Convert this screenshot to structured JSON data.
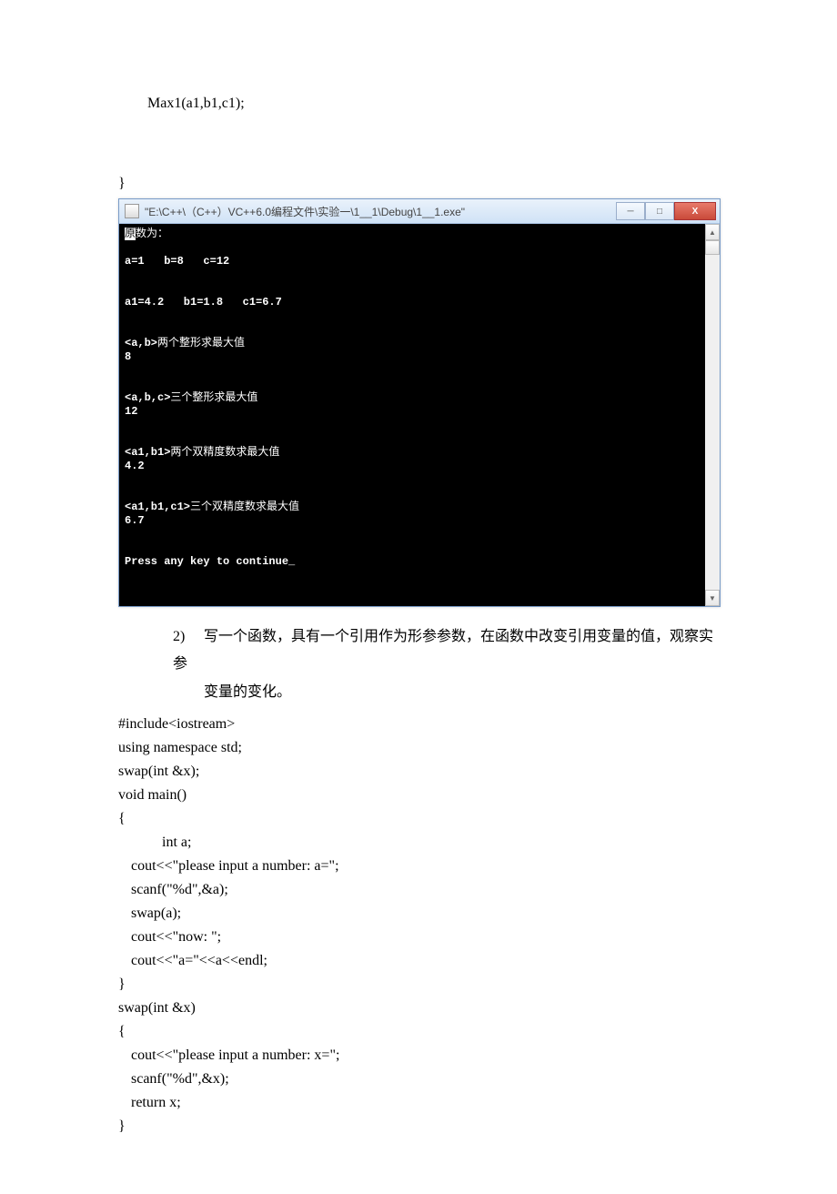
{
  "precode": {
    "l1": "Max1(a1,b1,c1);",
    "l2": "}"
  },
  "window": {
    "title": "\"E:\\C++\\（C++）VC++6.0编程文件\\实验一\\1__1\\Debug\\1__1.exe\"",
    "buttons": {
      "min": "─",
      "max": "□",
      "close": "X"
    }
  },
  "console": {
    "l1_hl": "原",
    "l1_rest": "数为：",
    "l2": "a=1   b=8   c=12",
    "l3": "a1=4.2   b1=1.8   c1=6.7",
    "l4a": "<a,b>",
    "l4b": "两个整形求最大值",
    "l5": "8",
    "l6a": "<a,b,c>",
    "l6b": "三个整形求最大值",
    "l7": "12",
    "l8a": "<a1,b1>",
    "l8b": "两个双精度数求最大值",
    "l9": "4.2",
    "l10a": "<a1,b1,c1>",
    "l10b": "三个双精度数求最大值",
    "l11": "6.7",
    "l12": "Press any key to continue_"
  },
  "question": {
    "num": "2)",
    "text1": "写一个函数，具有一个引用作为形参参数，在函数中改变引用变量的值，观察实参",
    "text2": "变量的变化。"
  },
  "code": {
    "l1": "#include<iostream>",
    "l2": "using namespace std;",
    "l3": "",
    "l4": "swap(int &x);",
    "l5": "void main()",
    "l6": "{",
    "l7": "int a;",
    "l8": "cout<<\"please input a number: a=\";",
    "l9": "scanf(\"%d\",&a);",
    "l10": "swap(a);",
    "l11": "cout<<\"now: \";",
    "l12": "cout<<\"a=\"<<a<<endl;",
    "l13": "}",
    "l14": "swap(int &x)",
    "l15": "{",
    "l16": "cout<<\"please input a number: x=\";",
    "l17": "scanf(\"%d\",&x);",
    "l18": "return x;",
    "l19": "}"
  }
}
